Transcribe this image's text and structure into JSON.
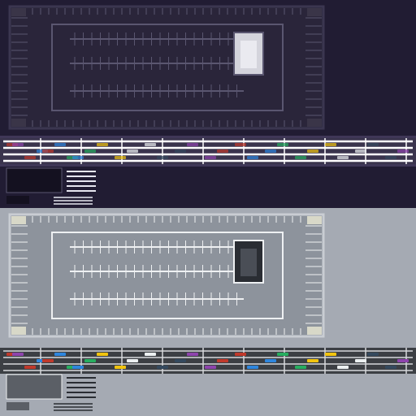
{
  "atlas": {
    "panels": [
      {
        "id": "night",
        "colors": {
          "background": "#211c33",
          "deck": "#2a253a",
          "border": "#3b3650",
          "stall_lines": "#5a5670",
          "ramp": "#d4d4dc",
          "glow": "#c8b8ff",
          "strip_bg": "#1b1826",
          "strip_line": "#ffffff"
        }
      },
      {
        "id": "day",
        "colors": {
          "background": "#a5aab3",
          "deck": "#8d939c",
          "border": "#c9cdd3",
          "stall_lines": "#eef0f2",
          "ramp": "#2a2d33",
          "glow": "#ffffff",
          "strip_bg": "#3c3f44",
          "strip_line": "#d7d9dc"
        }
      }
    ],
    "car_colors": [
      "#c0392b",
      "#2e86de",
      "#27ae60",
      "#f1c40f",
      "#ecf0f1",
      "#34495e",
      "#8e44ad"
    ]
  }
}
